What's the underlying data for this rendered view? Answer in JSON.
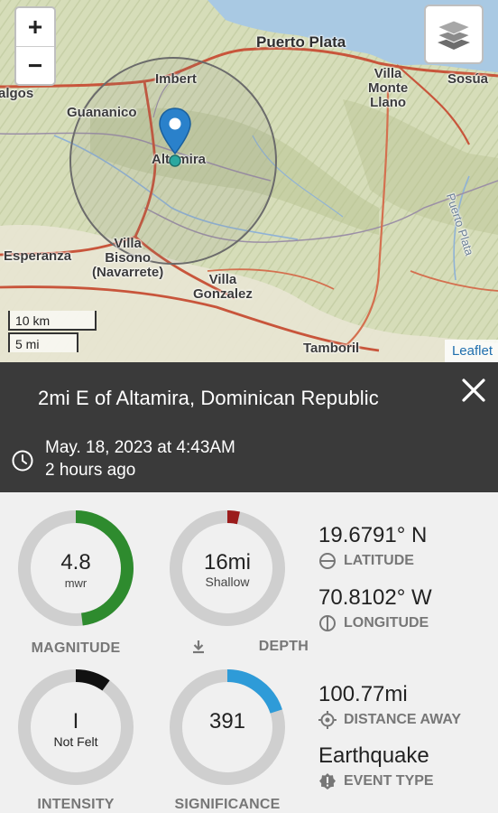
{
  "map": {
    "zoom_in": "+",
    "zoom_out": "−",
    "places": {
      "puerto_plata": "Puerto Plata",
      "villa_monte_llano": "Villa\nMonte\nLlano",
      "sosua": "Sosúa",
      "imbert": "Imbert",
      "guananico": "Guananico",
      "salcedo_partial": "algos",
      "altamira": "Altamira",
      "esperanza": "Esperanza",
      "villa_bisono": "Villa\nBisono\n(Navarrete)",
      "villa_gonzalez": "Villa\nGonzalez",
      "tamboril": "Tamboril",
      "rio": "Puerto Plata"
    },
    "scale_km": "10 km",
    "scale_mi": "5 mi",
    "attribution": "Leaflet"
  },
  "header": {
    "title": "2mi E of Altamira, Dominican Republic",
    "date": "May. 18, 2023 at 4:43AM",
    "ago": "2 hours ago"
  },
  "gauges": {
    "magnitude": {
      "value": "4.8",
      "unit": "mwr",
      "label": "MAGNITUDE",
      "fraction": 0.48,
      "color": "#2e8b2e"
    },
    "depth": {
      "value": "16mi",
      "sub": "Shallow",
      "label": "DEPTH",
      "fraction": 0.035,
      "color": "#9b1b1b"
    },
    "intensity": {
      "value": "I",
      "sub": "Not Felt",
      "label": "INTENSITY",
      "fraction": 0.1,
      "color": "#111111"
    },
    "significance": {
      "value": "391",
      "label": "SIGNIFICANCE",
      "fraction": 0.2,
      "color": "#2e9bd8"
    }
  },
  "info": {
    "latitude": {
      "value": "19.6791° N",
      "label": "LATITUDE"
    },
    "longitude": {
      "value": "70.8102° W",
      "label": "LONGITUDE"
    },
    "distance": {
      "value": "100.77mi",
      "label": "DISTANCE AWAY"
    },
    "event_type": {
      "value": "Earthquake",
      "label": "EVENT TYPE"
    }
  }
}
